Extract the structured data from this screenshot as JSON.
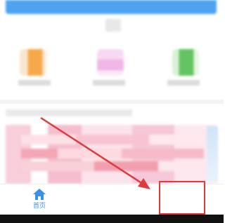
{
  "bottom_nav": {
    "home_label": "首页"
  },
  "colors": {
    "accent_blue": "#4da3f0",
    "nav_active": "#3a8fe8",
    "annotation_red": "#e03a3a"
  },
  "icons": {
    "home": "home-icon"
  }
}
